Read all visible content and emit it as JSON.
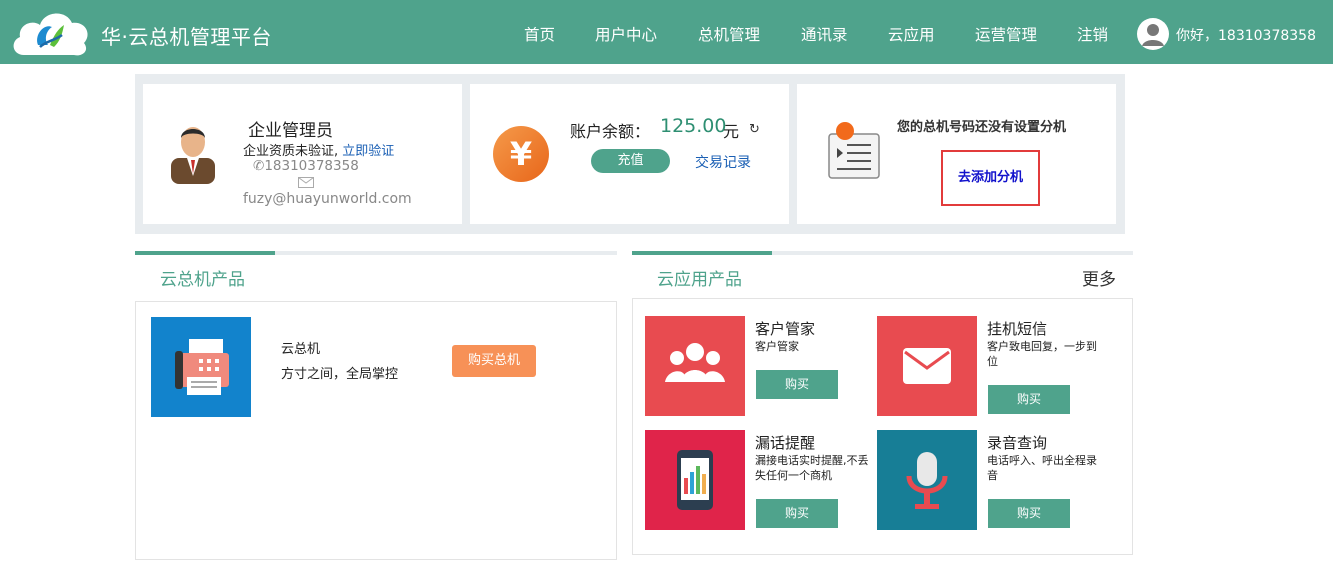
{
  "header": {
    "brand": "华·云总机管理平台",
    "nav": [
      "首页",
      "用户中心",
      "总机管理",
      "通讯录",
      "云应用",
      "运营管理",
      "注销"
    ],
    "greeting": "你好，18310378358",
    "bg_color": "#4fa38c"
  },
  "admin_card": {
    "title": "企业管理员",
    "verify_text": "企业资质未验证,",
    "verify_link": "立即验证",
    "phone": "18310378358",
    "email": "fuzy@huayunworld.com"
  },
  "balance_card": {
    "label": "账户余额：",
    "value": "125.00",
    "unit": "元",
    "yen_symbol": "¥",
    "refresh_symbol": "↻",
    "recharge_label": "充值",
    "history_label": "交易记录"
  },
  "extension_card": {
    "notice": "您的总机号码还没有设置分机",
    "add_label": "去添加分机"
  },
  "pbx_section": {
    "title": "云总机产品",
    "product": {
      "name": "云总机",
      "desc": "方寸之间，全局掌控",
      "buy_label": "购买总机"
    }
  },
  "apps_section": {
    "title": "云应用产品",
    "more_label": "更多",
    "apps": [
      {
        "name": "客户管家",
        "desc": "客户管家",
        "buy_label": "购买",
        "color": "#e84b50"
      },
      {
        "name": "挂机短信",
        "desc": "客户致电回复，一步到位",
        "buy_label": "购买",
        "color": "#e84b50"
      },
      {
        "name": "漏话提醒",
        "desc": "漏接电话实时提醒,不丢失任何一个商机",
        "buy_label": "购买",
        "color": "#e0244a"
      },
      {
        "name": "录音查询",
        "desc": "电话呼入、呼出全程录音",
        "buy_label": "购买",
        "color": "#177e96"
      }
    ]
  }
}
